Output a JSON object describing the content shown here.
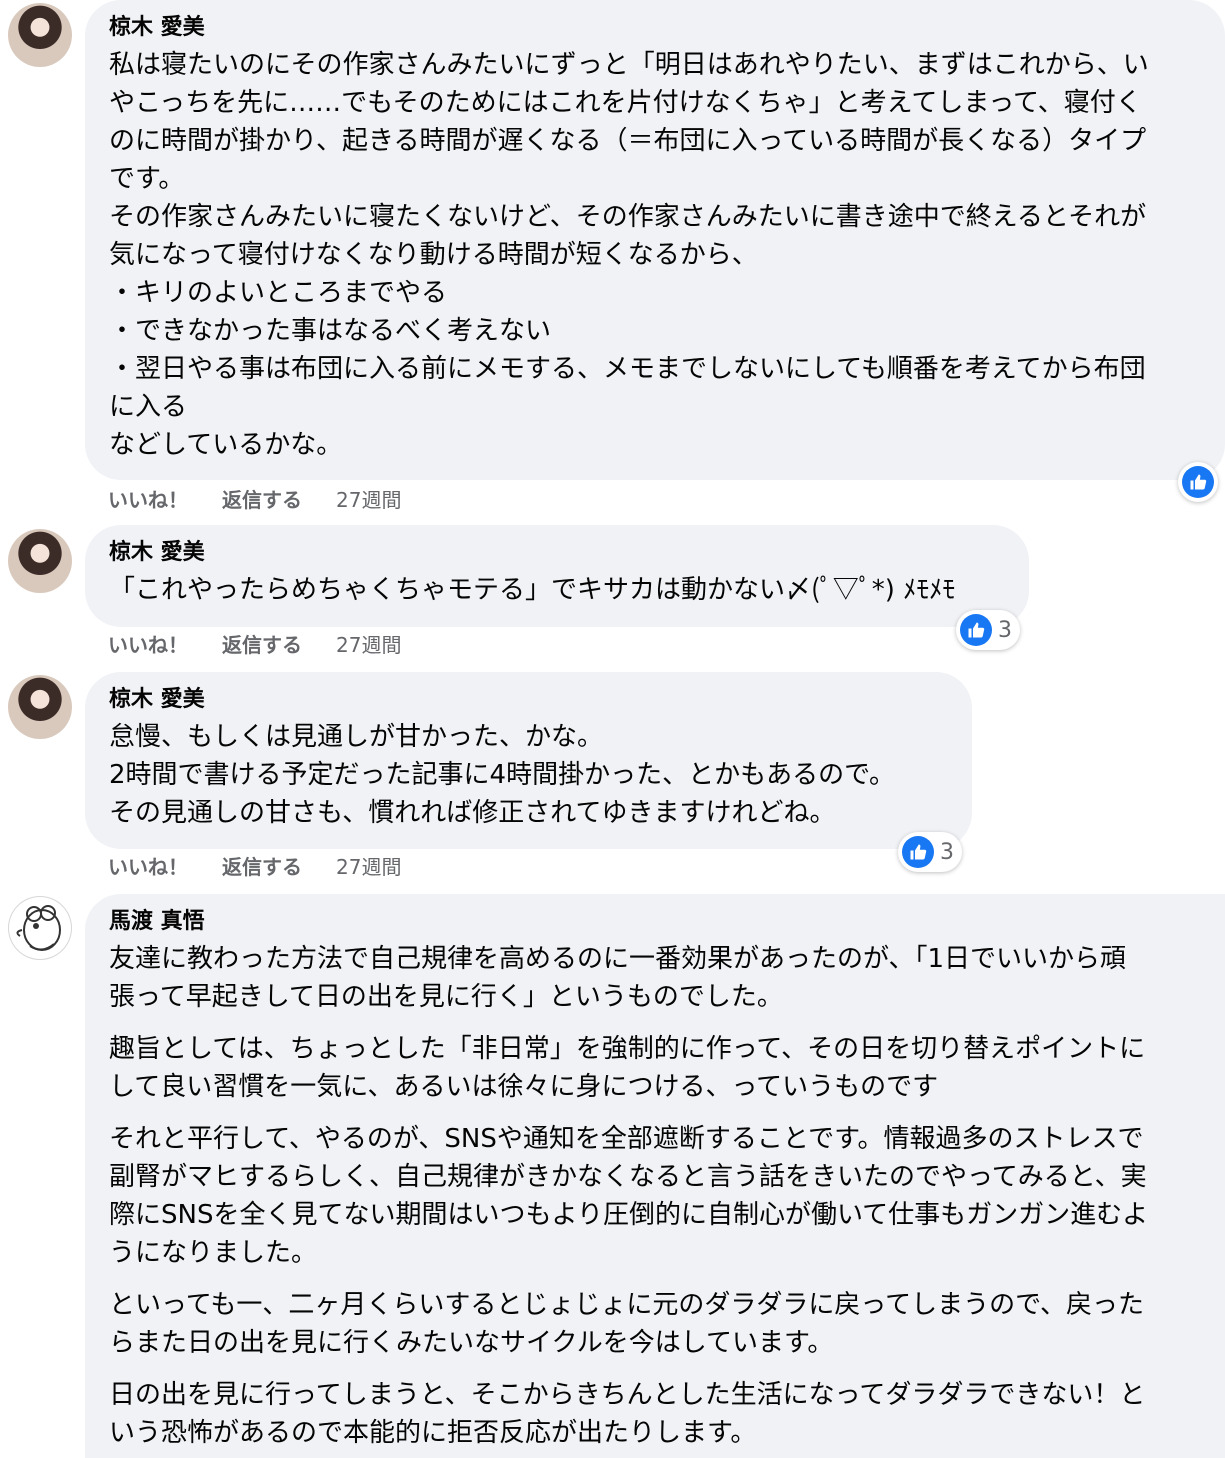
{
  "colors": {
    "like_blue": "#1877f2",
    "bubble_bg": "#f0f2f5",
    "meta_gray": "#65676b"
  },
  "comments": [
    {
      "author": "椋木 愛美",
      "avatar_icon": "profile-photo-icon",
      "lines": [
        "私は寝たいのにその作家さんみたいにずっと「明日はあれやりたい、まずはこれから、い",
        "やこっちを先に……でもそのためにはこれを片付けなくちゃ」と考えてしまって、寝付く",
        "のに時間が掛かり、起きる時間が遅くなる（＝布団に入っている時間が長くなる）タイプ",
        "です。",
        "その作家さんみたいに寝たくないけど、その作家さんみたいに書き途中で終えるとそれが",
        "気になって寝付けなくなり動ける時間が短くなるから、",
        "・キリのよいところまでやる",
        "・できなかった事はなるべく考えない",
        "・翌日やる事は布団に入る前にメモする、メモまでしないにしても順番を考えてから布団",
        "に入る",
        "などしているかな。"
      ],
      "like_label": "いいね！",
      "reply_label": "返信する",
      "time": "27週間"
    },
    {
      "author": "椋木 愛美",
      "avatar_icon": "profile-photo-icon",
      "lines": [
        "「これやったらめちゃくちゃモテる」でキサカは動かない〆(ﾟ▽ﾟ*) ﾒﾓﾒﾓ"
      ],
      "reaction_count": "3",
      "like_label": "いいね！",
      "reply_label": "返信する",
      "time": "27週間"
    },
    {
      "author": "椋木 愛美",
      "avatar_icon": "profile-photo-icon",
      "lines": [
        "怠慢、もしくは見通しが甘かった、かな。",
        "2時間で書ける予定だった記事に4時間掛かった、とかもあるので。",
        "その見通しの甘さも、慣れれば修正されてゆきますけれどね。"
      ],
      "reaction_count": "3",
      "like_label": "いいね！",
      "reply_label": "返信する",
      "time": "27週間"
    },
    {
      "author": "馬渡 真悟",
      "avatar_icon": "bird-avatar-icon",
      "paragraphs": [
        [
          "友達に教わった方法で自己規律を高めるのに一番効果があったのが、「1日でいいから頑",
          "張って早起きして日の出を見に行く」というものでした。"
        ],
        [
          "趣旨としては、ちょっとした「非日常」を強制的に作って、その日を切り替えポイントに",
          "して良い習慣を一気に、あるいは徐々に身につける、っていうものです"
        ],
        [
          "それと平行して、やるのが、SNSや通知を全部遮断することです。情報過多のストレスで",
          "副腎がマヒするらしく、自己規律がきかなくなると言う話をきいたのでやってみると、実",
          "際にSNSを全く見てない期間はいつもより圧倒的に自制心が働いて仕事もガンガン進むよ",
          "うになりました。"
        ],
        [
          "といっても一、二ヶ月くらいするとじょじょに元のダラダラに戻ってしまうので、戻った",
          "らまた日の出を見に行くみたいなサイクルを今はしています。"
        ],
        [
          "日の出を見に行ってしまうと、そこからきちんとした生活になってダラダラできない！と",
          "いう恐怖があるので本能的に拒否反応が出たりします。"
        ]
      ]
    }
  ]
}
